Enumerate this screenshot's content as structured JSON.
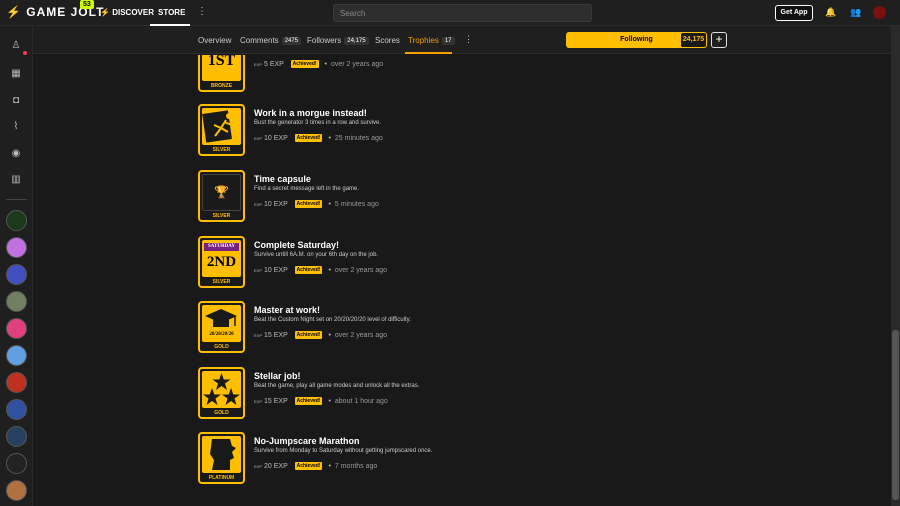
{
  "topbar": {
    "logo_text": "GAME JOLT",
    "logo_badge": "53",
    "discover_label": "DISCOVER",
    "store_label": "STORE",
    "search_placeholder": "Search",
    "get_app_label": "Get App"
  },
  "subnav": {
    "tabs": [
      {
        "label": "Overview"
      },
      {
        "label": "Comments",
        "count": "2475"
      },
      {
        "label": "Followers",
        "count": "24,175"
      },
      {
        "label": "Scores"
      },
      {
        "label": "Trophies",
        "count": "17"
      }
    ],
    "following_label": "Following",
    "following_count": "24,175"
  },
  "trophies": [
    {
      "title": "",
      "description": "",
      "exp": "5 EXP",
      "achieved": "Achieved!",
      "time": "over 2 years ago",
      "tier": "BRONZE",
      "art_text": "1ST"
    },
    {
      "title": "Work in a morgue instead!",
      "description": "Bust the generator 3 times in a row and survive.",
      "exp": "10 EXP",
      "achieved": "Achieved!",
      "time": "25 minutes ago",
      "tier": "SILVER"
    },
    {
      "title": "Time capsule",
      "description": "Find a secret message left in the game.",
      "exp": "10 EXP",
      "achieved": "Achieved!",
      "time": "5 minutes ago",
      "tier": "SILVER"
    },
    {
      "title": "Complete Saturday!",
      "description": "Survive untill 6A.M. on your 6th day on the job.",
      "exp": "10 EXP",
      "achieved": "Achieved!",
      "time": "over 2 years ago",
      "tier": "SILVER",
      "art_top": "SATURDAY",
      "art_text": "2ND"
    },
    {
      "title": "Master at work!",
      "description": "Beat the Custom Night set on 20/20/20/20 level of difficulty.",
      "exp": "15 EXP",
      "achieved": "Achieved!",
      "time": "over 2 years ago",
      "tier": "GOLD",
      "art_text": "20/20/20/20"
    },
    {
      "title": "Stellar job!",
      "description": "Beat the game, play all game modes and unlock all the extras.",
      "exp": "15 EXP",
      "achieved": "Achieved!",
      "time": "about 1 hour ago",
      "tier": "GOLD"
    },
    {
      "title": "No-Jumpscare Marathon",
      "description": "Survive from Monday to Saturday without getting jumpscared once.",
      "exp": "20 EXP",
      "achieved": "Achieved!",
      "time": "7 months ago",
      "tier": "PLATINUM"
    }
  ],
  "exp_icon_text": "EXP",
  "colors": {
    "accent": "#ffbf00",
    "background": "#191919",
    "panel": "#1f1f1f"
  }
}
